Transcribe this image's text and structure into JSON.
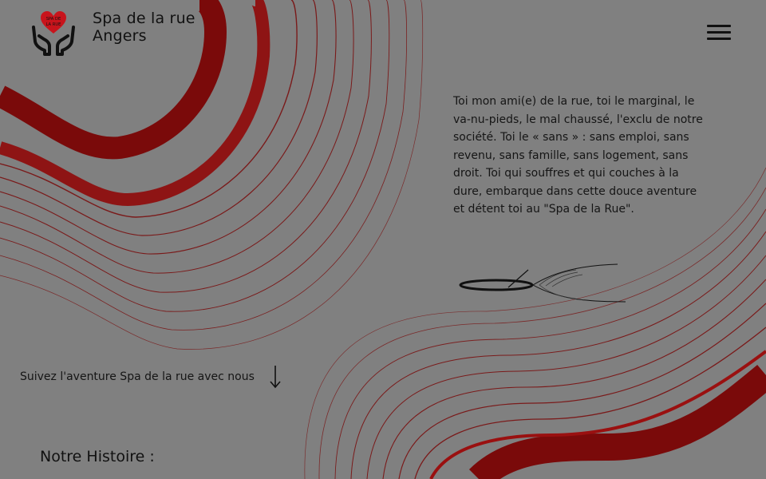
{
  "header": {
    "brand_line1": "Spa de la rue",
    "brand_line2": "Angers",
    "logo_text_line1": "SPA DE",
    "logo_text_line2": "LA RUE"
  },
  "intro": {
    "text": "Toi mon ami(e) de la rue, toi le marginal, le va-nu-pieds, le mal chaussé, l'exclu de notre société. Toi le « sans » : sans emploi, sans revenu, sans famille, sans logement, sans droit. Toi qui souffres et qui couches à la dure, embarque dans cette douce aventure et détent toi au \"Spa de la Rue\"."
  },
  "cta": {
    "label": "Suivez l'aventure Spa de la rue avec nous"
  },
  "history": {
    "title": "Notre Histoire :"
  },
  "colors": {
    "background": "#808080",
    "accent": "#7a0a0a",
    "logo_heart": "#c8141c",
    "text": "#151515"
  },
  "icons": {
    "logo": "hands-holding-heart-icon",
    "menu": "hamburger-menu-icon",
    "arrow": "arrow-down-icon"
  }
}
